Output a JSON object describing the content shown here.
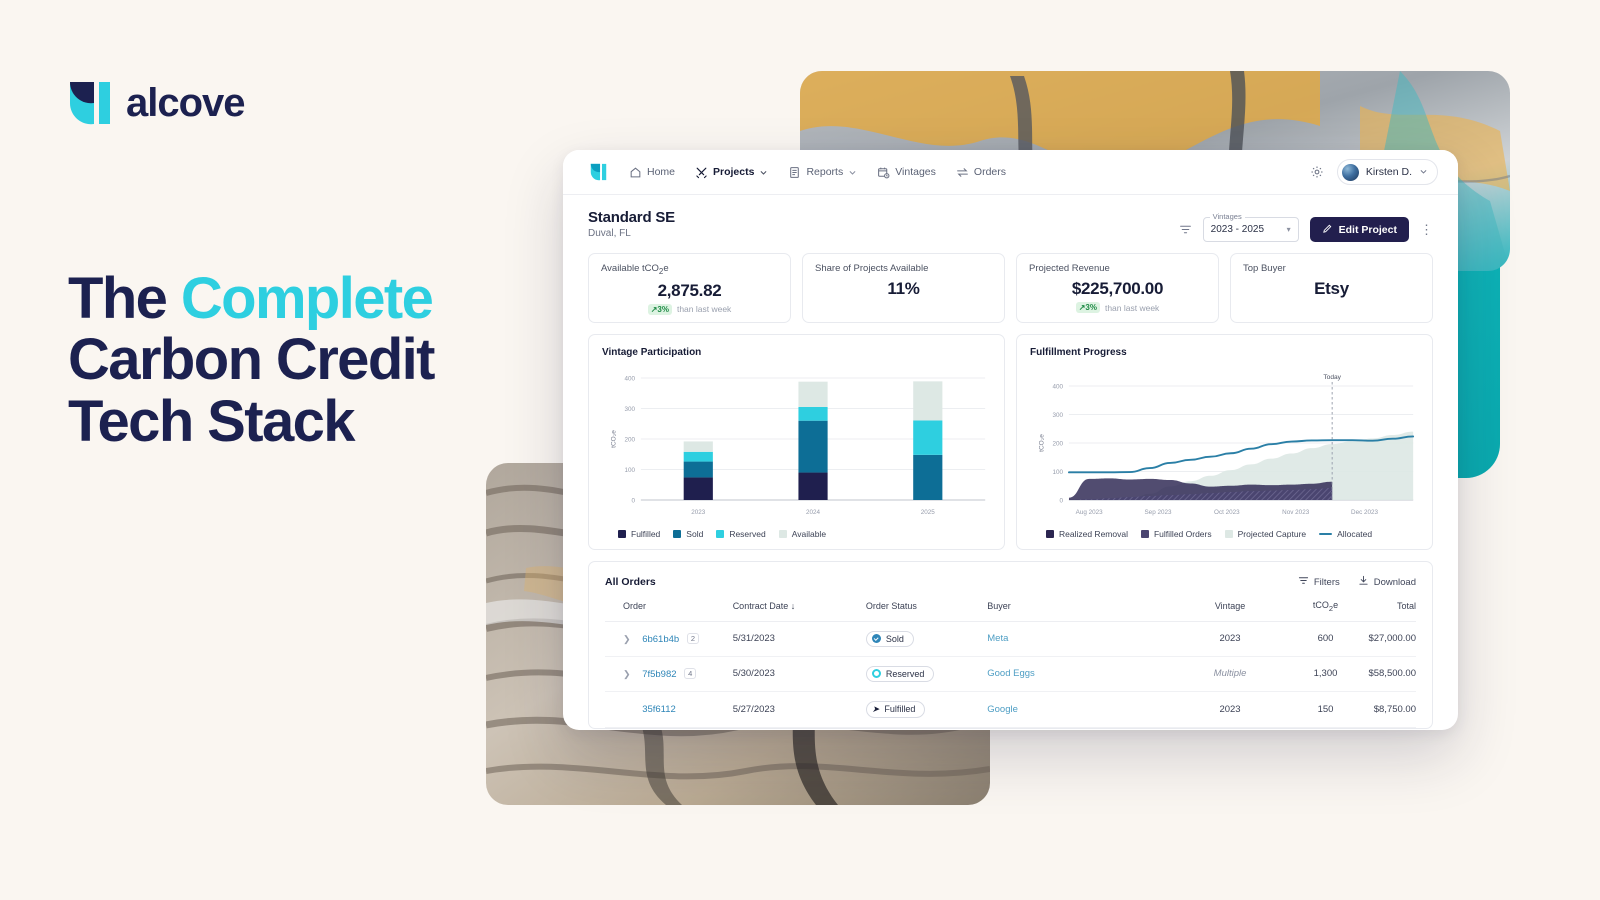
{
  "brand": {
    "name": "alcove",
    "logo_icon": "alcove-logo-icon",
    "accent": "#2ecfe0",
    "navy": "#1c2150"
  },
  "marketing": {
    "headline_line1_a": "The ",
    "headline_line1_b": "Complete",
    "headline_line2": "Carbon Credit",
    "headline_line3": "Tech Stack"
  },
  "app": {
    "nav": {
      "items": [
        {
          "label": "Home",
          "icon": "home-icon",
          "active": false,
          "caret": false
        },
        {
          "label": "Projects",
          "icon": "tools-icon",
          "active": true,
          "caret": true
        },
        {
          "label": "Reports",
          "icon": "document-icon",
          "active": false,
          "caret": true
        },
        {
          "label": "Vintages",
          "icon": "calendar-clock-icon",
          "active": false,
          "caret": false
        },
        {
          "label": "Orders",
          "icon": "transfer-arrows-icon",
          "active": false,
          "caret": false
        }
      ],
      "settings_icon": "gear-icon",
      "user_name": "Kirsten D.",
      "user_caret": "chevron-down-icon"
    },
    "page_header": {
      "title": "Standard SE",
      "subtitle": "Duval, FL",
      "filter_icon": "filter-icon",
      "vintages_label": "Vintages",
      "vintages_value": "2023 - 2025",
      "edit_button": "Edit Project",
      "edit_icon": "pencil-icon",
      "more_icon": "kebab-menu-icon"
    },
    "kpis": [
      {
        "label": "Available tCO",
        "label_sub": "2",
        "label_tail": "e",
        "value": "2,875.82",
        "delta": "3%",
        "delta_text": "than last week",
        "has_delta": true
      },
      {
        "label": "Share of Projects Available",
        "value": "11%",
        "has_delta": false
      },
      {
        "label": "Projected Revenue",
        "value": "$225,700.00",
        "delta": "3%",
        "delta_text": "than last week",
        "has_delta": true
      },
      {
        "label": "Top Buyer",
        "value": "Etsy",
        "has_delta": false
      }
    ],
    "orders_table": {
      "title": "All Orders",
      "filters_label": "Filters",
      "download_label": "Download",
      "columns": [
        "Order",
        "Contract Date",
        "Order Status",
        "Buyer",
        "Vintage",
        "tCO₂e",
        "Total"
      ],
      "sorted_column": "Contract Date",
      "sort_direction": "desc",
      "rows": [
        {
          "expandable": true,
          "order_id": "6b61b4b",
          "count": "2",
          "date": "5/31/2023",
          "status": "Sold",
          "status_kind": "sold",
          "buyer": "Meta",
          "vintage": "2023",
          "vintage_muted": false,
          "tco2e": "600",
          "total": "$27,000.00"
        },
        {
          "expandable": true,
          "order_id": "7f5b982",
          "count": "4",
          "date": "5/30/2023",
          "status": "Reserved",
          "status_kind": "reserved",
          "buyer": "Good Eggs",
          "vintage": "Multiple",
          "vintage_muted": true,
          "tco2e": "1,300",
          "total": "$58,500.00"
        },
        {
          "expandable": false,
          "order_id": "35f6112",
          "count": "",
          "date": "5/27/2023",
          "status": "Fulfilled",
          "status_kind": "fulfilled",
          "buyer": "Google",
          "vintage": "2023",
          "vintage_muted": false,
          "tco2e": "150",
          "total": "$8,750.00"
        }
      ]
    }
  },
  "chart_data": [
    {
      "type": "bar",
      "stacked": true,
      "title": "Vintage Participation",
      "xlabel": "",
      "ylabel": "tCO₂e",
      "categories": [
        "2023",
        "2024",
        "2025"
      ],
      "ylim": [
        0,
        400
      ],
      "yticks": [
        0,
        100,
        200,
        300,
        400
      ],
      "grid": true,
      "legend_position": "bottom",
      "series": [
        {
          "name": "Fulfilled",
          "color": "#1f1f4e",
          "values": [
            74,
            90,
            0
          ]
        },
        {
          "name": "Sold",
          "color": "#0d6e96",
          "values": [
            52,
            170,
            148
          ]
        },
        {
          "name": "Reserved",
          "color": "#2ecfe0",
          "values": [
            32,
            45,
            113
          ]
        },
        {
          "name": "Available",
          "color": "#dde8e4",
          "values": [
            34,
            83,
            128
          ]
        }
      ]
    },
    {
      "type": "area",
      "title": "Fulfillment Progress",
      "xlabel": "",
      "ylabel": "tCO₂e",
      "ylim": [
        0,
        400
      ],
      "yticks": [
        0,
        100,
        200,
        300,
        400
      ],
      "xticks": [
        "Aug 2023",
        "Sep 2023",
        "Oct 2023",
        "Nov 2023",
        "Dec 2023"
      ],
      "grid": true,
      "annotation": "Today",
      "legend_position": "bottom",
      "series": [
        {
          "name": "Realized Removal",
          "color": "#2b2550",
          "type": "area",
          "values": [
            8,
            74,
            76,
            72,
            74,
            70,
            58,
            47,
            50,
            54,
            52,
            54,
            57,
            64,
            95,
            120,
            145,
            170
          ]
        },
        {
          "name": "Fulfilled Orders",
          "color": "#4a4570",
          "type": "area-hatch",
          "values": [
            0,
            2,
            6,
            10,
            14,
            17,
            20,
            24,
            28,
            31,
            33,
            35,
            38,
            42,
            52,
            66,
            86,
            110
          ]
        },
        {
          "name": "Projected Capture",
          "color": "#dde8e4",
          "type": "area",
          "values": [
            0,
            0,
            0,
            0,
            22,
            48,
            66,
            85,
            105,
            125,
            145,
            163,
            182,
            196,
            206,
            216,
            228,
            240
          ]
        },
        {
          "name": "Allocated",
          "color": "#2a7fa6",
          "type": "line",
          "values": [
            97,
            97,
            97,
            98,
            112,
            130,
            141,
            152,
            164,
            180,
            196,
            205,
            209,
            210,
            210,
            208,
            215,
            223
          ]
        }
      ]
    }
  ]
}
